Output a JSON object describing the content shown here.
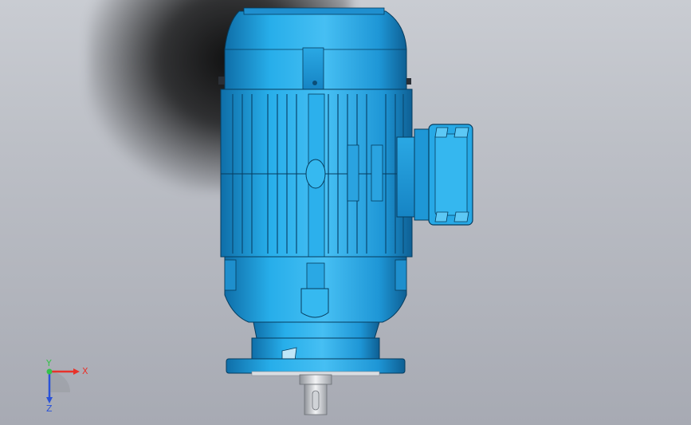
{
  "viewport": {
    "background_top": "#c9ccd2",
    "background_bottom": "#a7aab3",
    "model_color": "#22a6e6",
    "model_dark": "#0f6ea8",
    "model_light": "#5cc8f5"
  },
  "triad": {
    "x_label": "X",
    "y_label": "Y",
    "z_label": "Z",
    "x_color": "#e8322a",
    "y_color": "#35c24a",
    "z_color": "#2a52d8"
  }
}
